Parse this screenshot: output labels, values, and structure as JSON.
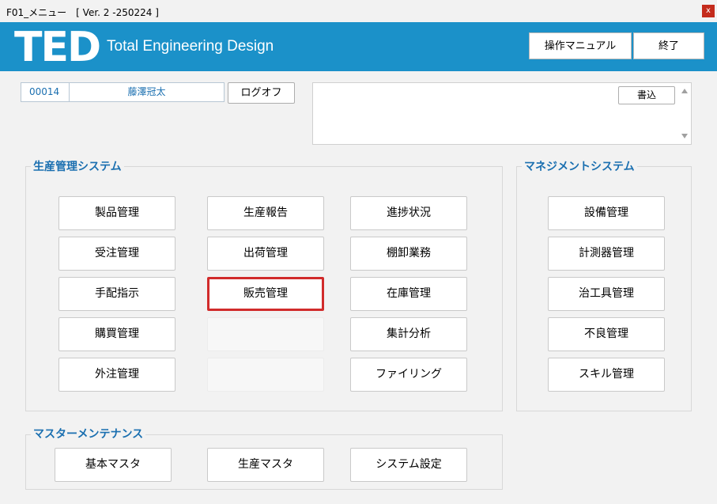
{
  "window": {
    "title": "F01_メニュー　[ Ver. 2 -250224 ]",
    "close_glyph": "x"
  },
  "header": {
    "logo": "TED",
    "subtitle": "Total Engineering Design",
    "manual_label": "操作マニュアル",
    "exit_label": "終了"
  },
  "user": {
    "code": "00014",
    "name": "藤澤冠太",
    "logoff_label": "ログオフ"
  },
  "memo": {
    "write_label": "書込"
  },
  "production": {
    "title": "生産管理システム",
    "col1": [
      "製品管理",
      "受注管理",
      "手配指示",
      "購買管理",
      "外注管理"
    ],
    "col2": [
      "生産報告",
      "出荷管理",
      "販売管理",
      "",
      ""
    ],
    "col3": [
      "進捗状況",
      "棚卸業務",
      "在庫管理",
      "集計分析",
      "ファイリング"
    ]
  },
  "management": {
    "title": "マネジメントシステム",
    "items": [
      "設備管理",
      "計測器管理",
      "治工具管理",
      "不良管理",
      "スキル管理"
    ]
  },
  "master": {
    "title": "マスターメンテナンス",
    "items": [
      "基本マスタ",
      "生産マスタ",
      "システム設定"
    ]
  }
}
